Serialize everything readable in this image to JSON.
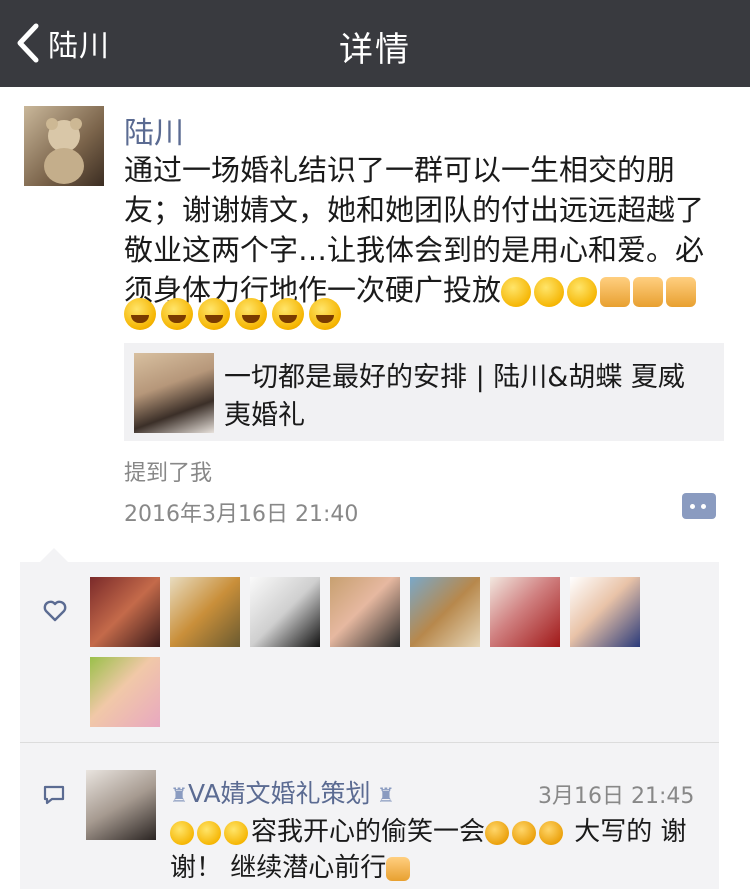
{
  "navbar": {
    "back_label": "陆川",
    "title": "详情"
  },
  "post": {
    "author": "陆川",
    "text": "通过一场婚礼结识了一群可以一生相交的朋友；谢谢婧文，她和她团队的付出远远超越了敬业这两个字…让我体会到的是用心和爱。必须身体力行地作一次硬广投放",
    "emoji_inline": [
      "angry-emoji",
      "angry-emoji",
      "angry-emoji",
      "fist-emoji",
      "fist-emoji",
      "fist-emoji"
    ],
    "emoji_row": [
      "grin-emoji",
      "grin-emoji",
      "grin-emoji",
      "grin-emoji",
      "grin-emoji",
      "grin-emoji"
    ],
    "link": {
      "title": "一切都是最好的安排 | 陆川&胡蝶 夏威夷婚礼"
    },
    "mention": "提到了我",
    "time": "2016年3月16日 21:40"
  },
  "likes": {
    "count_avatars": 8,
    "icon": "heart-outline-icon"
  },
  "comments": [
    {
      "name": "VA婧文婚礼策划",
      "time": "3月16日 21:45",
      "text_part1": "容我开心的偷笑一会",
      "text_part2": " 大写的 谢谢！ 继续潜心前行"
    }
  ],
  "colors": {
    "navbar": "#393a3f",
    "link_name": "#5b6b92",
    "panel": "#f3f3f5",
    "meta": "#888888"
  }
}
